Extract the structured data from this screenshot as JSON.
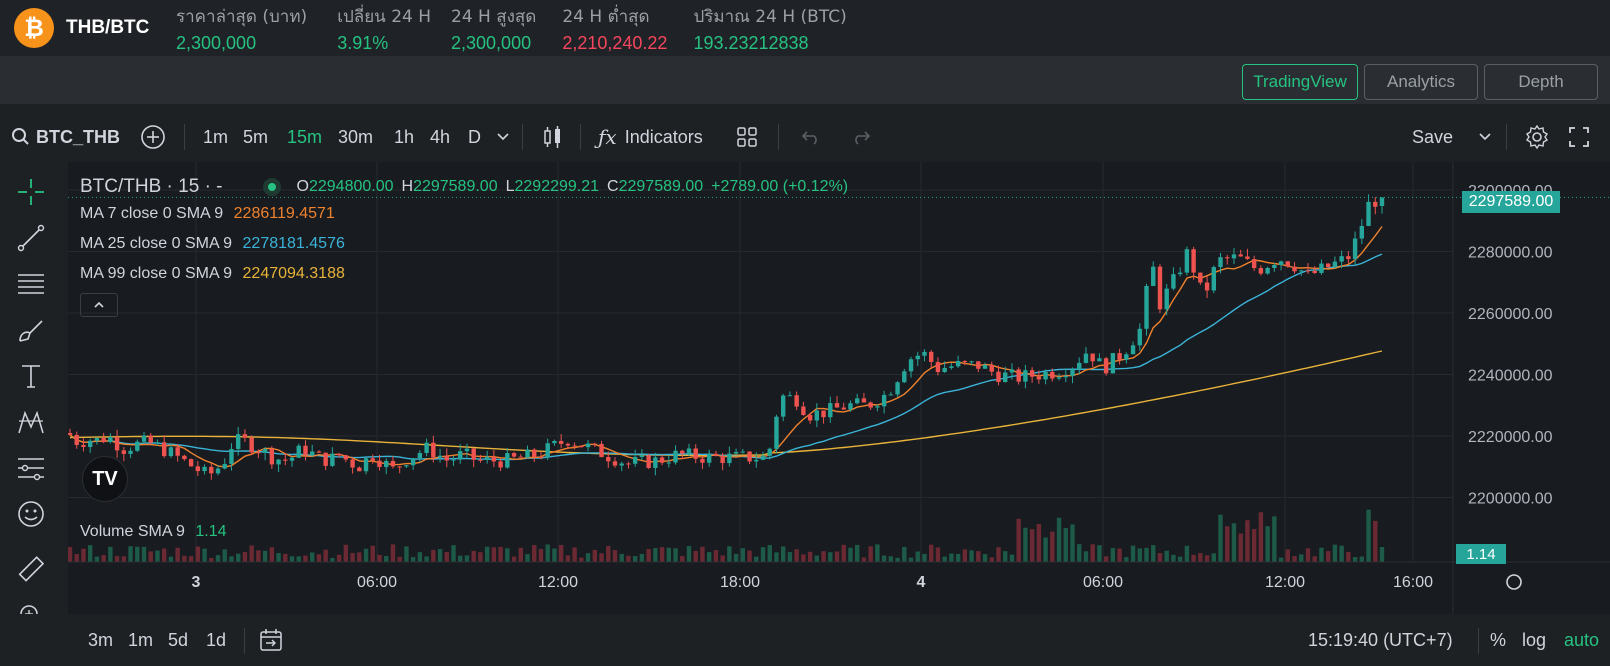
{
  "ticker": {
    "pair": "THB/BTC",
    "coin_symbol": "₿",
    "stats": [
      {
        "label": "ราคาล่าสุด (บาท)",
        "value": "2,300,000",
        "color": "green"
      },
      {
        "label": "เปลี่ยน 24 H",
        "value": "3.91%",
        "color": "green"
      },
      {
        "label": "24 H สูงสุด",
        "value": "2,300,000",
        "color": "green"
      },
      {
        "label": "24 H ต่ำสุด",
        "value": "2,210,240.22",
        "color": "red"
      },
      {
        "label": "ปริมาณ 24 H (BTC)",
        "value": "193.23212838",
        "color": "green"
      }
    ]
  },
  "tabs": [
    "TradingView",
    "Analytics",
    "Depth"
  ],
  "toolbar": {
    "symbol": "BTC_THB",
    "intervals": [
      "1m",
      "5m",
      "15m",
      "30m",
      "1h",
      "4h",
      "D"
    ],
    "selected_interval": "15m",
    "indicators_label": "Indicators",
    "save_label": "Save"
  },
  "legend": {
    "title": "BTC/THB · 15 · -",
    "o_label": "O",
    "o": "2294800.00",
    "h_label": "H",
    "h": "2297589.00",
    "l_label": "L",
    "l": "2292299.21",
    "c_label": "C",
    "c": "2297589.00",
    "change": "+2789.00 (+0.12%)",
    "ma7_label": "MA 7 close 0 SMA 9",
    "ma7": "2286119.4571",
    "ma25_label": "MA 25 close 0 SMA 9",
    "ma25": "2278181.4576",
    "ma99_label": "MA 99 close 0 SMA 9",
    "ma99": "2247094.3188",
    "volume_label": "Volume SMA 9",
    "volume": "1.14"
  },
  "price_axis": [
    "2300000.00",
    "2280000.00",
    "2260000.00",
    "2240000.00",
    "2220000.00",
    "2200000.00"
  ],
  "last_price_badge": "2297589.00",
  "volume_badge": "1.14",
  "time_axis": [
    "3",
    "06:00",
    "12:00",
    "18:00",
    "4",
    "06:00",
    "12:00",
    "16:00"
  ],
  "bottom": {
    "ranges": [
      "3m",
      "1m",
      "5d",
      "1d"
    ],
    "clock": "15:19:40 (UTC+7)",
    "percent_label": "%",
    "log_label": "log",
    "auto_label": "auto"
  },
  "colors": {
    "up": "#26a69a",
    "down": "#ef5350",
    "ma7": "#f0822d",
    "ma25": "#3bb3d8",
    "ma99": "#e8b33a",
    "accent": "#26c281"
  }
}
